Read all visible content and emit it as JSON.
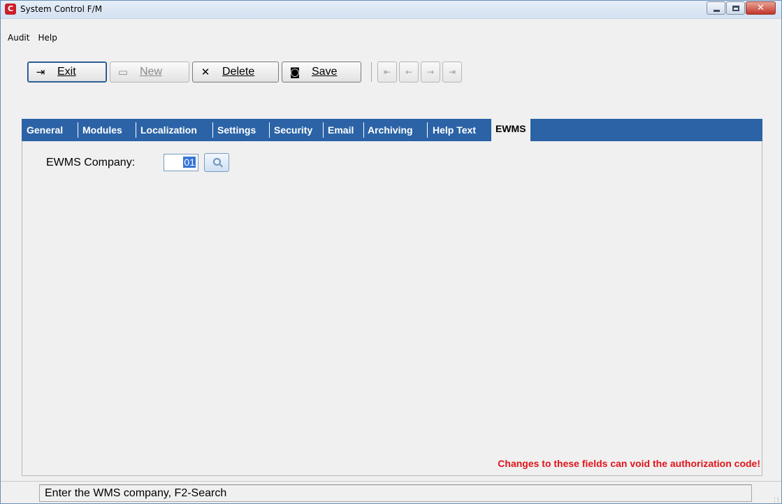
{
  "window": {
    "title": "System Control F/M",
    "icon_letter": "C"
  },
  "menu": [
    {
      "label": "Audit"
    },
    {
      "label": "Help"
    }
  ],
  "toolbar": {
    "exit_label": "Exit",
    "new_label": "New",
    "delete_label": "Delete",
    "save_label": "Save",
    "exit_icon": "exit-icon",
    "new_icon": "new-icon",
    "delete_icon": "delete-icon",
    "save_icon": "save-icon",
    "nav_buttons": [
      "first-record-icon",
      "previous-record-icon",
      "next-record-icon",
      "last-record-icon"
    ]
  },
  "tabs": [
    {
      "label": "General"
    },
    {
      "label": "Modules"
    },
    {
      "label": "Localization"
    },
    {
      "label": "Settings"
    },
    {
      "label": "Security"
    },
    {
      "label": "Email"
    },
    {
      "label": "Archiving"
    },
    {
      "label": "Help Text"
    },
    {
      "label": "EWMS",
      "active": true
    }
  ],
  "form": {
    "ewms_company_label": "EWMS Company:",
    "ewms_company_value": "01"
  },
  "warning": "Changes to these fields can void the authorization code!",
  "status": {
    "message": "Enter the WMS company, F2-Search"
  },
  "colors": {
    "tab_strip": "#2b63a6",
    "warning": "#e0141a",
    "selection": "#3875d7"
  }
}
